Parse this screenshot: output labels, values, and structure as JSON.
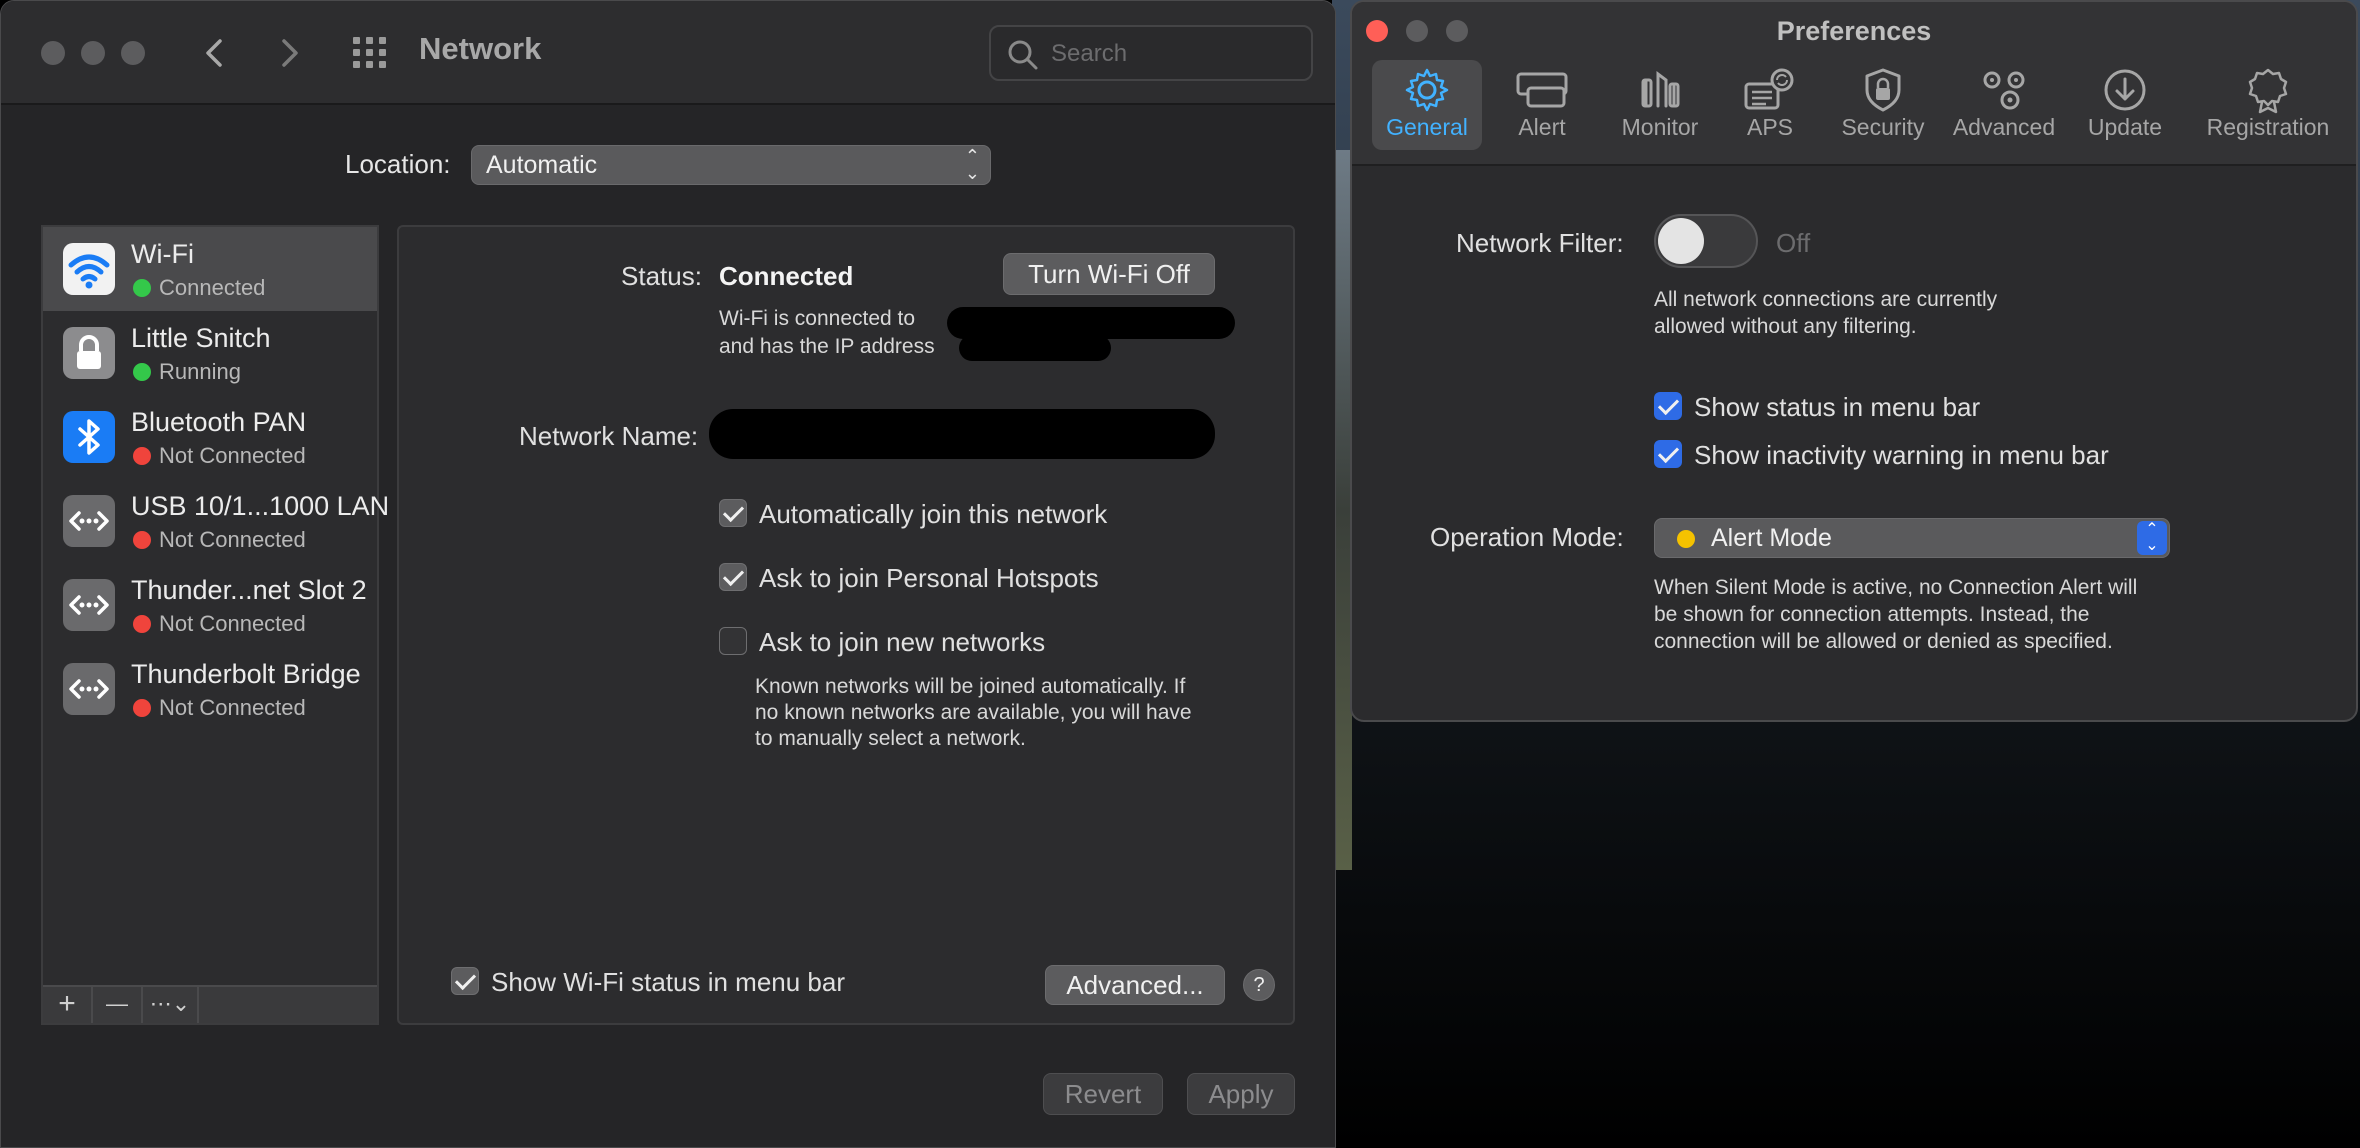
{
  "network_window": {
    "title": "Network",
    "search_placeholder": "Search",
    "location_label": "Location:",
    "location_value": "Automatic",
    "services": [
      {
        "name": "Wi-Fi",
        "status": "Connected",
        "status_color": "#34c84a",
        "icon": "wifi-icon"
      },
      {
        "name": "Little Snitch",
        "status": "Running",
        "status_color": "#34c84a",
        "icon": "lock-icon"
      },
      {
        "name": "Bluetooth PAN",
        "status": "Not Connected",
        "status_color": "#f0443c",
        "icon": "bluetooth-icon"
      },
      {
        "name": "USB 10/1...1000 LAN",
        "status": "Not Connected",
        "status_color": "#f0443c",
        "icon": "ethernet-icon"
      },
      {
        "name": "Thunder...net Slot  2",
        "status": "Not Connected",
        "status_color": "#f0443c",
        "icon": "ethernet-icon"
      },
      {
        "name": "Thunderbolt Bridge",
        "status": "Not Connected",
        "status_color": "#f0443c",
        "icon": "ethernet-icon"
      }
    ],
    "sidebar_buttons": {
      "add": "+",
      "remove": "—",
      "action": "⋯⌄"
    },
    "status_label": "Status:",
    "status_value": "Connected",
    "turn_off_button": "Turn Wi-Fi Off",
    "connected_line1": "Wi-Fi is connected to",
    "connected_line2": "and has the IP address",
    "network_name_label": "Network Name:",
    "options": [
      {
        "label": "Automatically join this network",
        "checked": true
      },
      {
        "label": "Ask to join Personal Hotspots",
        "checked": true
      },
      {
        "label": "Ask to join new networks",
        "checked": false
      }
    ],
    "known_networks_note": [
      "Known networks will be joined automatically. If",
      "no known networks are available, you will have",
      "to manually select a network."
    ],
    "show_status_label": "Show Wi-Fi status in menu bar",
    "advanced_button": "Advanced...",
    "help_button": "?",
    "revert_button": "Revert",
    "apply_button": "Apply"
  },
  "preferences_window": {
    "title": "Preferences",
    "tabs": [
      {
        "label": "General",
        "icon": "gear-icon",
        "selected": true
      },
      {
        "label": "Alert",
        "icon": "alert-windows-icon",
        "selected": false
      },
      {
        "label": "Monitor",
        "icon": "monitor-icon",
        "selected": false
      },
      {
        "label": "APS",
        "icon": "aps-icon",
        "selected": false
      },
      {
        "label": "Security",
        "icon": "shield-lock-icon",
        "selected": false
      },
      {
        "label": "Advanced",
        "icon": "gears-icon",
        "selected": false
      },
      {
        "label": "Update",
        "icon": "download-icon",
        "selected": false
      },
      {
        "label": "Registration",
        "icon": "badge-icon",
        "selected": false
      }
    ],
    "network_filter_label": "Network Filter:",
    "network_filter_state": "Off",
    "filter_note": [
      "All network connections are currently",
      "allowed without any filtering."
    ],
    "show_status_label": "Show status in menu bar",
    "show_inactivity_label": "Show inactivity warning in menu bar",
    "operation_mode_label": "Operation Mode:",
    "operation_mode_value": "Alert Mode",
    "silent_note": [
      "When Silent Mode is active, no Connection Alert will",
      "be shown for connection attempts. Instead, the",
      "connection will be allowed or denied as specified."
    ],
    "accent_color": "#42b2ff"
  }
}
